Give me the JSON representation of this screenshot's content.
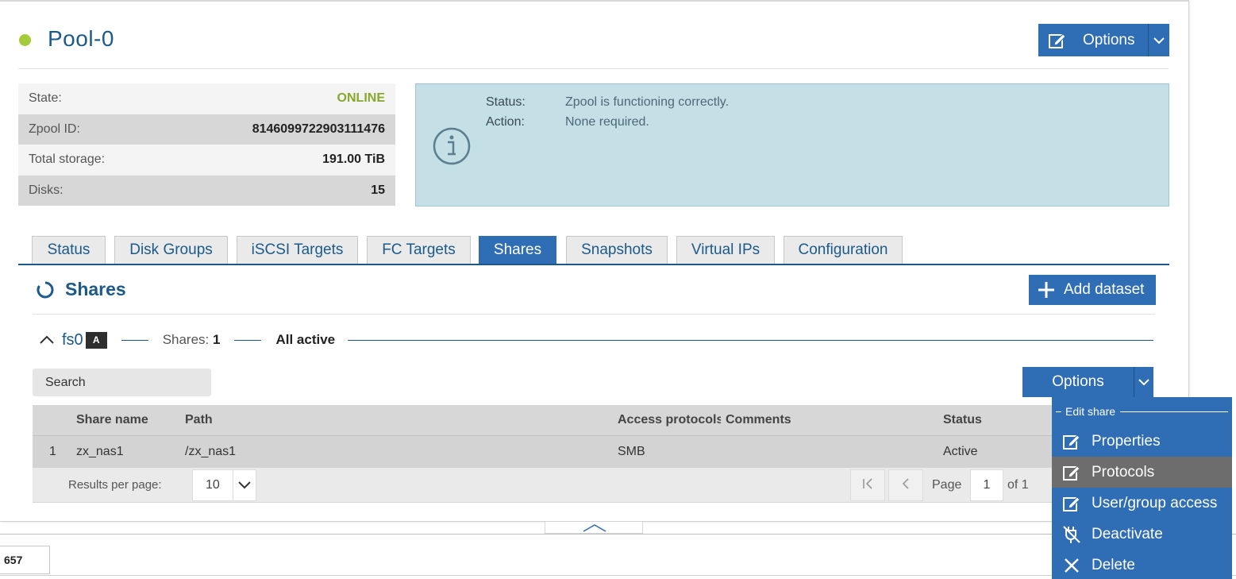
{
  "pool": {
    "name": "Pool-0",
    "options_label": "Options",
    "props": [
      {
        "key": "State:",
        "value": "ONLINE"
      },
      {
        "key": "Zpool ID:",
        "value": "8146099722903111476"
      },
      {
        "key": "Total storage:",
        "value": "191.00 TiB"
      },
      {
        "key": "Disks:",
        "value": "15"
      }
    ],
    "status": {
      "status_key": "Status:",
      "status_value": "Zpool is functioning correctly.",
      "action_key": "Action:",
      "action_value": "None required."
    }
  },
  "tabs": [
    "Status",
    "Disk Groups",
    "iSCSI Targets",
    "FC Targets",
    "Shares",
    "Snapshots",
    "Virtual IPs",
    "Configuration"
  ],
  "active_tab": "Shares",
  "shares": {
    "title": "Shares",
    "add_label": "Add dataset",
    "dataset": {
      "name": "fs0",
      "badge": "A",
      "shares_label": "Shares:",
      "shares_count": "1",
      "state": "All active"
    },
    "search_placeholder": "Search",
    "options_label": "Options",
    "columns": [
      "Share name",
      "Path",
      "Access protocols",
      "Comments",
      "Status"
    ],
    "rows": [
      {
        "index": "1",
        "name": "zx_nas1",
        "path": "/zx_nas1",
        "protocols": "SMB",
        "comments": "",
        "status": "Active"
      }
    ],
    "footer": {
      "results_label": "Results per page:",
      "results_value": "10",
      "page_label": "Page",
      "page_value": "1",
      "of_label": "of 1"
    }
  },
  "menu": {
    "header": "Edit share",
    "items": [
      {
        "label": "Properties",
        "icon": "edit-icon"
      },
      {
        "label": "Protocols",
        "icon": "edit-icon"
      },
      {
        "label": "User/group access",
        "icon": "edit-icon"
      },
      {
        "label": "Deactivate",
        "icon": "unplug-icon"
      },
      {
        "label": "Delete",
        "icon": "close-icon"
      }
    ],
    "hovered": "Protocols"
  },
  "bottom_tab": "657",
  "colors": {
    "accent": "#2f6db5",
    "online": "#86a92c",
    "status_bg": "#c5dfe6",
    "menu_hover": "#6d6d6d"
  }
}
